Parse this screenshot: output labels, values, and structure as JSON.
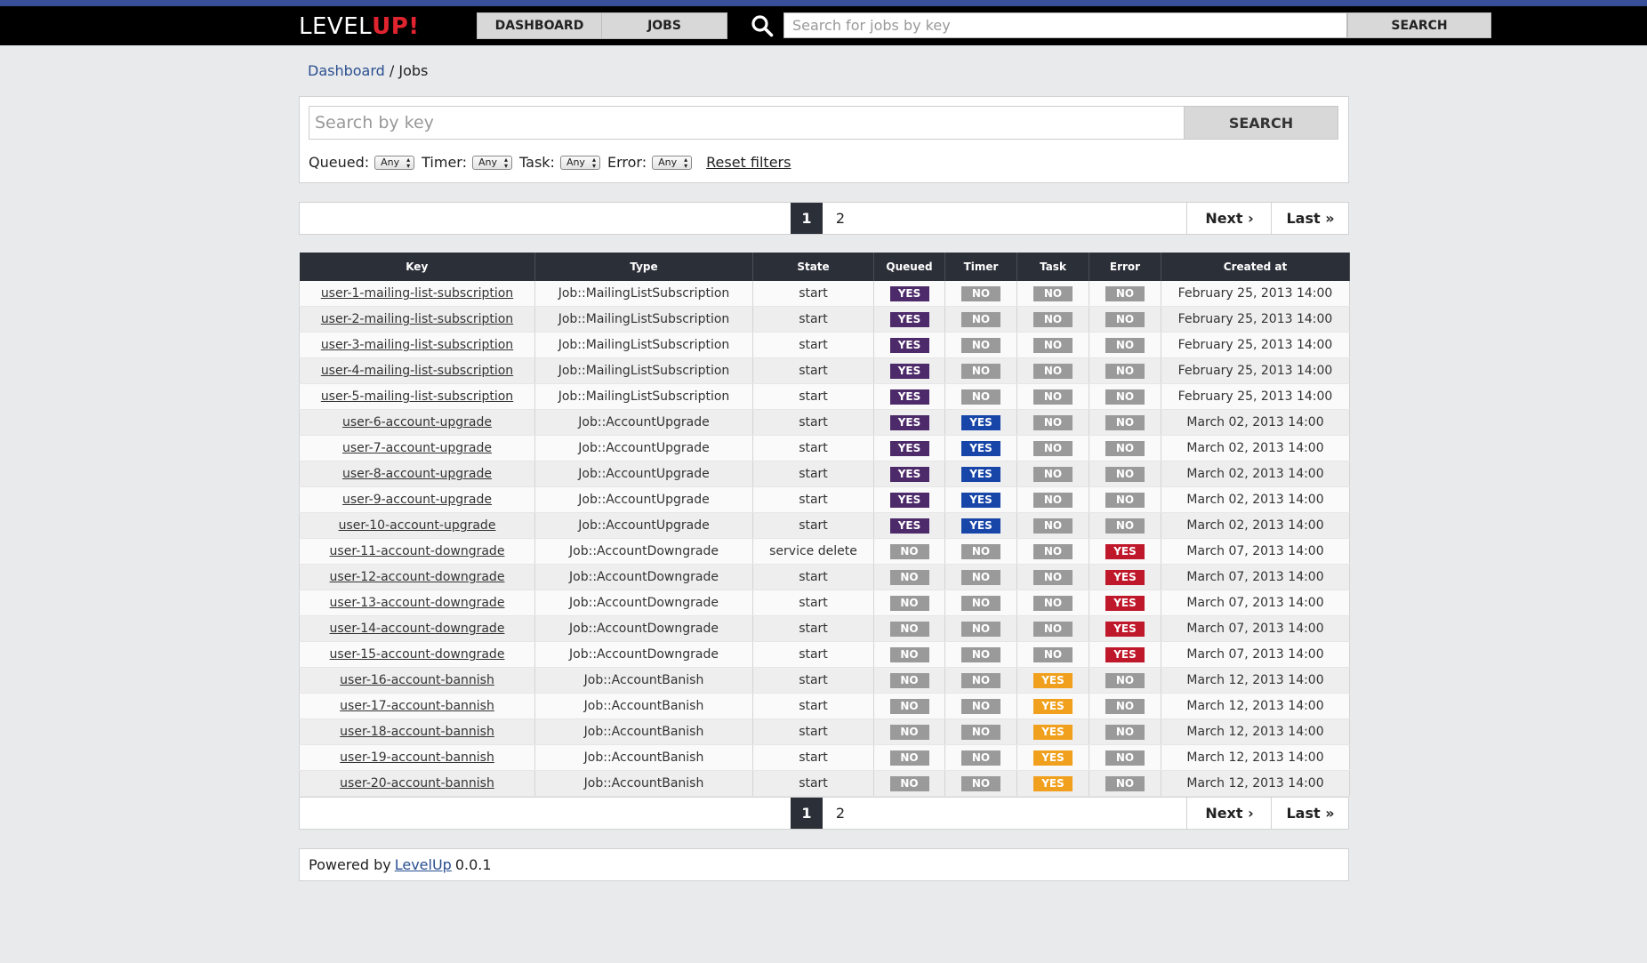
{
  "app": {
    "brand_level": "LEVEL",
    "brand_up": "UP!"
  },
  "nav": {
    "dashboard_label": "DASHBOARD",
    "jobs_label": "JOBS",
    "search_placeholder": "Search for jobs by key",
    "search_button": "SEARCH"
  },
  "breadcrumb": {
    "home": "Dashboard",
    "separator": " / ",
    "current": "Jobs"
  },
  "filters": {
    "search_placeholder": "Search by key",
    "search_button": "SEARCH",
    "queued_label": "Queued:",
    "timer_label": "Timer:",
    "task_label": "Task:",
    "error_label": "Error:",
    "queued_value": "Any",
    "timer_value": "Any",
    "task_value": "Any",
    "error_value": "Any",
    "reset_label": "Reset filters"
  },
  "pagination": {
    "page1": "1",
    "page2": "2",
    "next": "Next ›",
    "last": "Last »",
    "current_page": 1
  },
  "table": {
    "headers": [
      "Key",
      "Type",
      "State",
      "Queued",
      "Timer",
      "Task",
      "Error",
      "Created at"
    ],
    "rows": [
      {
        "key": "user-1-mailing-list-subscription",
        "type": "Job::MailingListSubscription",
        "state": "start",
        "queued": "YES",
        "timer": "NO",
        "task": "NO",
        "error": "NO",
        "created": "February 25, 2013 14:00"
      },
      {
        "key": "user-2-mailing-list-subscription",
        "type": "Job::MailingListSubscription",
        "state": "start",
        "queued": "YES",
        "timer": "NO",
        "task": "NO",
        "error": "NO",
        "created": "February 25, 2013 14:00"
      },
      {
        "key": "user-3-mailing-list-subscription",
        "type": "Job::MailingListSubscription",
        "state": "start",
        "queued": "YES",
        "timer": "NO",
        "task": "NO",
        "error": "NO",
        "created": "February 25, 2013 14:00"
      },
      {
        "key": "user-4-mailing-list-subscription",
        "type": "Job::MailingListSubscription",
        "state": "start",
        "queued": "YES",
        "timer": "NO",
        "task": "NO",
        "error": "NO",
        "created": "February 25, 2013 14:00"
      },
      {
        "key": "user-5-mailing-list-subscription",
        "type": "Job::MailingListSubscription",
        "state": "start",
        "queued": "YES",
        "timer": "NO",
        "task": "NO",
        "error": "NO",
        "created": "February 25, 2013 14:00"
      },
      {
        "key": "user-6-account-upgrade",
        "type": "Job::AccountUpgrade",
        "state": "start",
        "queued": "YES",
        "timer": "YES",
        "task": "NO",
        "error": "NO",
        "created": "March 02, 2013 14:00"
      },
      {
        "key": "user-7-account-upgrade",
        "type": "Job::AccountUpgrade",
        "state": "start",
        "queued": "YES",
        "timer": "YES",
        "task": "NO",
        "error": "NO",
        "created": "March 02, 2013 14:00"
      },
      {
        "key": "user-8-account-upgrade",
        "type": "Job::AccountUpgrade",
        "state": "start",
        "queued": "YES",
        "timer": "YES",
        "task": "NO",
        "error": "NO",
        "created": "March 02, 2013 14:00"
      },
      {
        "key": "user-9-account-upgrade",
        "type": "Job::AccountUpgrade",
        "state": "start",
        "queued": "YES",
        "timer": "YES",
        "task": "NO",
        "error": "NO",
        "created": "March 02, 2013 14:00"
      },
      {
        "key": "user-10-account-upgrade",
        "type": "Job::AccountUpgrade",
        "state": "start",
        "queued": "YES",
        "timer": "YES",
        "task": "NO",
        "error": "NO",
        "created": "March 02, 2013 14:00"
      },
      {
        "key": "user-11-account-downgrade",
        "type": "Job::AccountDowngrade",
        "state": "service delete",
        "queued": "NO",
        "timer": "NO",
        "task": "NO",
        "error": "YES",
        "created": "March 07, 2013 14:00"
      },
      {
        "key": "user-12-account-downgrade",
        "type": "Job::AccountDowngrade",
        "state": "start",
        "queued": "NO",
        "timer": "NO",
        "task": "NO",
        "error": "YES",
        "created": "March 07, 2013 14:00"
      },
      {
        "key": "user-13-account-downgrade",
        "type": "Job::AccountDowngrade",
        "state": "start",
        "queued": "NO",
        "timer": "NO",
        "task": "NO",
        "error": "YES",
        "created": "March 07, 2013 14:00"
      },
      {
        "key": "user-14-account-downgrade",
        "type": "Job::AccountDowngrade",
        "state": "start",
        "queued": "NO",
        "timer": "NO",
        "task": "NO",
        "error": "YES",
        "created": "March 07, 2013 14:00"
      },
      {
        "key": "user-15-account-downgrade",
        "type": "Job::AccountDowngrade",
        "state": "start",
        "queued": "NO",
        "timer": "NO",
        "task": "NO",
        "error": "YES",
        "created": "March 07, 2013 14:00"
      },
      {
        "key": "user-16-account-bannish",
        "type": "Job::AccountBanish",
        "state": "start",
        "queued": "NO",
        "timer": "NO",
        "task": "YES",
        "error": "NO",
        "created": "March 12, 2013 14:00"
      },
      {
        "key": "user-17-account-bannish",
        "type": "Job::AccountBanish",
        "state": "start",
        "queued": "NO",
        "timer": "NO",
        "task": "YES",
        "error": "NO",
        "created": "March 12, 2013 14:00"
      },
      {
        "key": "user-18-account-bannish",
        "type": "Job::AccountBanish",
        "state": "start",
        "queued": "NO",
        "timer": "NO",
        "task": "YES",
        "error": "NO",
        "created": "March 12, 2013 14:00"
      },
      {
        "key": "user-19-account-bannish",
        "type": "Job::AccountBanish",
        "state": "start",
        "queued": "NO",
        "timer": "NO",
        "task": "YES",
        "error": "NO",
        "created": "March 12, 2013 14:00"
      },
      {
        "key": "user-20-account-bannish",
        "type": "Job::AccountBanish",
        "state": "start",
        "queued": "NO",
        "timer": "NO",
        "task": "YES",
        "error": "NO",
        "created": "March 12, 2013 14:00"
      }
    ]
  },
  "footer": {
    "prefix": "Powered by",
    "link": "LevelUp",
    "version": "0.0.1"
  },
  "colors": {
    "topbar": "#000000",
    "accent_stripe": "#3a4f9a",
    "brand_up": "#e0242f",
    "queued_yes": "#4d2a6a",
    "timer_yes": "#1746a8",
    "task_yes": "#f0a01c",
    "error_yes": "#c0182b",
    "no_badge": "#9a9a9a",
    "table_header": "#2b2f38"
  },
  "icons": {
    "search": "search-icon"
  }
}
